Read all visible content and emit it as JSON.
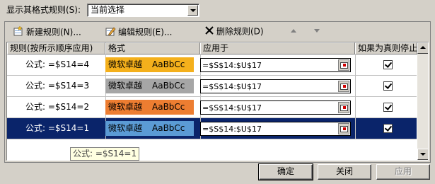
{
  "top": {
    "show_label": "显示其格式规则(S):",
    "scope_value": "当前选择"
  },
  "toolbar": {
    "new_rule": "新建规则(N)...",
    "edit_rule": "编辑规则(E)...",
    "delete_rule": "删除规则(D)"
  },
  "columns": {
    "rule": "规则(按所示顺序应用)",
    "format": "格式",
    "applies_to": "应用于",
    "stop_if_true": "如果为真则停止"
  },
  "rules": [
    {
      "formula": "公式: =$S14=4",
      "preview_cn": "微软卓越",
      "preview_en": "AaBbCc",
      "bg": "#f4b01c",
      "fg": "#000000",
      "applies": "=$S$14:$U$17",
      "stop": true,
      "selected": false
    },
    {
      "formula": "公式: =$S14=3",
      "preview_cn": "微软卓越",
      "preview_en": "AaBbCc",
      "bg": "#a6a6a6",
      "fg": "#000000",
      "applies": "=$S$14:$U$17",
      "stop": true,
      "selected": false
    },
    {
      "formula": "公式: =$S14=2",
      "preview_cn": "微软卓越",
      "preview_en": "AaBbCc",
      "bg": "#ed7d31",
      "fg": "#000000",
      "applies": "=$S$14:$U$17",
      "stop": true,
      "selected": false
    },
    {
      "formula": "公式: =$S14=1",
      "preview_cn": "微软卓越",
      "preview_en": "AaBbCc",
      "bg": "#5b9bd5",
      "fg": "#000000",
      "applies": "=$S$14:$U$17",
      "stop": true,
      "selected": true
    }
  ],
  "tooltip": "公式: =$S14=1",
  "buttons": {
    "ok": "确定",
    "close": "关闭",
    "apply": "应用"
  }
}
